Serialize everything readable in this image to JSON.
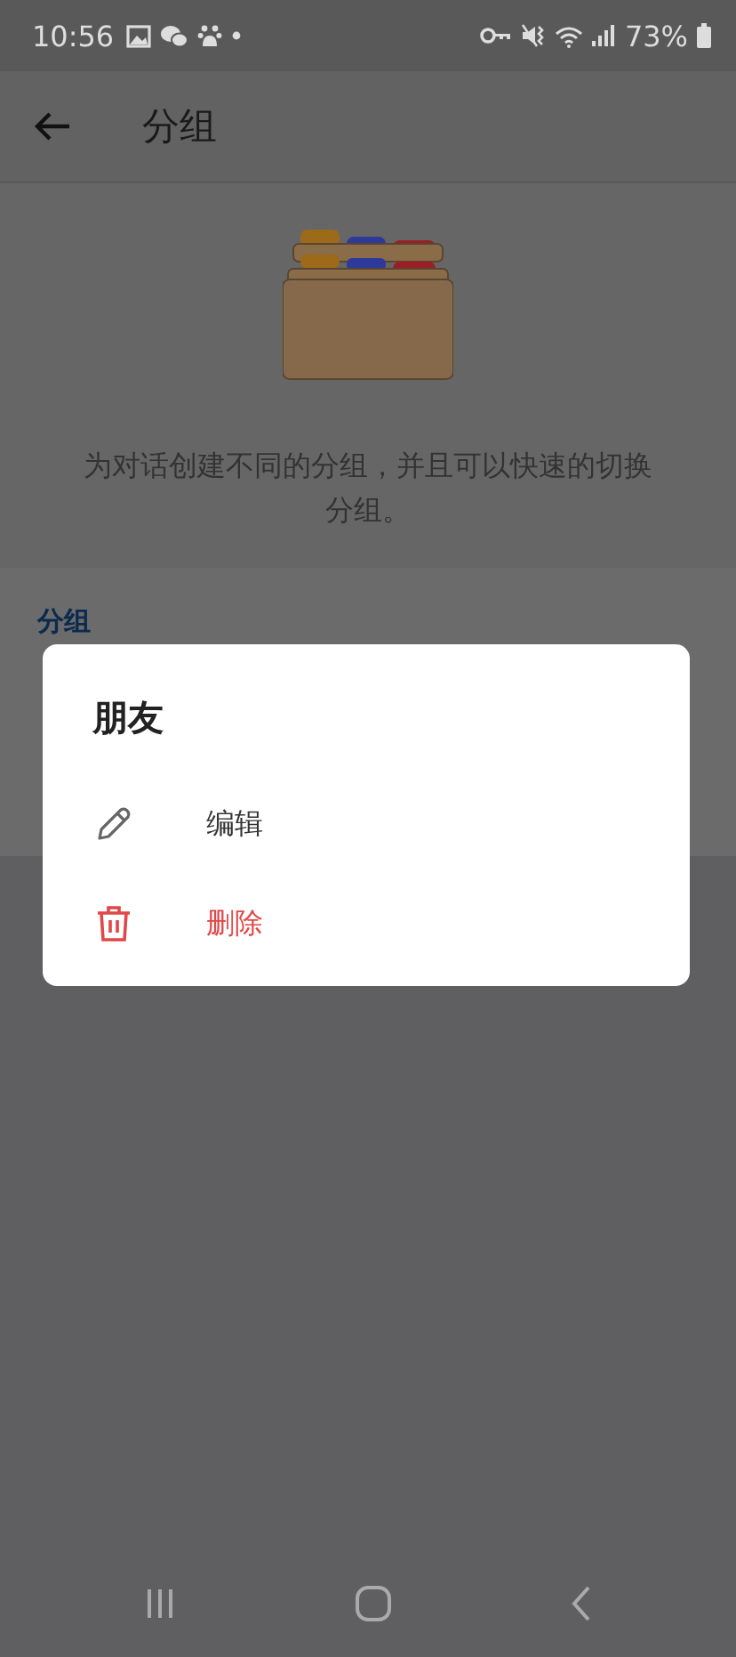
{
  "status_bar": {
    "time": "10:56",
    "battery": "73%"
  },
  "app_bar": {
    "title": "分组"
  },
  "intro": {
    "text": "为对话创建不同的分组，并且可以快速的切换分组。"
  },
  "section": {
    "header": "分组"
  },
  "dialog": {
    "title": "朋友",
    "actions": [
      {
        "label": "编辑",
        "kind": "edit"
      },
      {
        "label": "删除",
        "kind": "delete"
      }
    ]
  }
}
